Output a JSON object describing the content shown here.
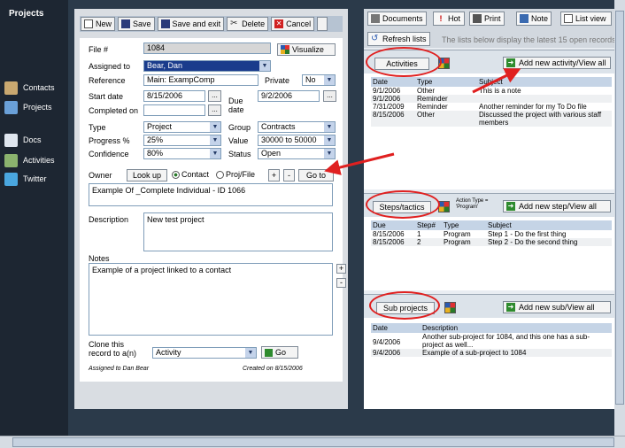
{
  "nav": {
    "title": "Projects",
    "items": [
      {
        "label": "Contacts",
        "icon": "contacts-icon"
      },
      {
        "label": "Projects",
        "icon": "projects-icon"
      },
      {
        "label": "Docs",
        "icon": "docs-icon"
      },
      {
        "label": "Activities",
        "icon": "activities-icon"
      },
      {
        "label": "Twitter",
        "icon": "twitter-icon"
      }
    ]
  },
  "toolbar": {
    "new": "New",
    "save": "Save",
    "save_exit": "Save and exit",
    "delete": "Delete",
    "cancel": "Cancel"
  },
  "form": {
    "file_label": "File #",
    "file_value": "1084",
    "visualize": "Visualize",
    "assigned_label": "Assigned to",
    "assigned_value": "Bear, Dan",
    "reference_label": "Reference",
    "reference_value": "Main: ExampComp",
    "private_label": "Private",
    "private_value": "No",
    "start_label": "Start date",
    "start_value": "8/15/2006",
    "completed_label": "Completed on",
    "completed_value": "",
    "due_label": "Due date",
    "due_value": "9/2/2006",
    "type_label": "Type",
    "type_value": "Project",
    "group_label": "Group",
    "group_value": "Contracts",
    "progress_label": "Progress %",
    "progress_value": "25%",
    "value_label": "Value",
    "value_value": "30000 to 50000",
    "confidence_label": "Confidence",
    "confidence_value": "80%",
    "status_label": "Status",
    "status_value": "Open",
    "owner_label": "Owner",
    "lookup": "Look up",
    "contact_radio": "Contact",
    "projfile_radio": "Proj/File",
    "plus": "+",
    "minus": "-",
    "goto": "Go to",
    "owner_value": "Example Of _Complete Individual - ID 1066",
    "description_label": "Description",
    "description_value": "New test project",
    "notes_label": "Notes",
    "notes_value": "Example of a project linked to a contact",
    "clone_label": "Clone this record to a(n)",
    "clone_value": "Activity",
    "go": "Go",
    "assigned_footer": "Assigned to Dan Bear",
    "created_footer": "Created on 8/15/2006"
  },
  "right": {
    "documents": "Documents",
    "hot": "Hot",
    "print": "Print",
    "note": "Note",
    "listview": "List view",
    "refresh": "Refresh lists",
    "notice": "The lists below display the latest 15 open records",
    "activities": {
      "title": "Activities",
      "add": "Add new activity/View all",
      "headers": [
        "Date",
        "Type",
        "Subject"
      ],
      "rows": [
        [
          "9/1/2006",
          "Other",
          "This is a note"
        ],
        [
          "9/1/2006",
          "Reminder",
          ""
        ],
        [
          "7/31/2009",
          "Reminder",
          "Another reminder for my To Do file"
        ],
        [
          "8/15/2006",
          "Other",
          "Discussed the project with various staff members"
        ]
      ]
    },
    "steps": {
      "title": "Steps/tactics",
      "action_type": "Action Type = 'Program'",
      "add": "Add new step/View all",
      "headers": [
        "Due",
        "Step#",
        "Type",
        "Subject"
      ],
      "rows": [
        [
          "8/15/2006",
          "1",
          "Program",
          "Step 1 - Do the first thing"
        ],
        [
          "8/15/2006",
          "2",
          "Program",
          "Step 2 - Do the second thing"
        ]
      ]
    },
    "subprojects": {
      "title": "Sub projects",
      "add": "Add new sub/View all",
      "headers": [
        "Date",
        "Description"
      ],
      "rows": [
        [
          "9/4/2006",
          "Another sub-project for 1084, and this one has a sub-project as well..."
        ],
        [
          "9/4/2006",
          "Example of a sub-project to 1084"
        ]
      ]
    }
  },
  "colors": {
    "highlight": "#e02020",
    "selected": "#1a3c8c"
  }
}
